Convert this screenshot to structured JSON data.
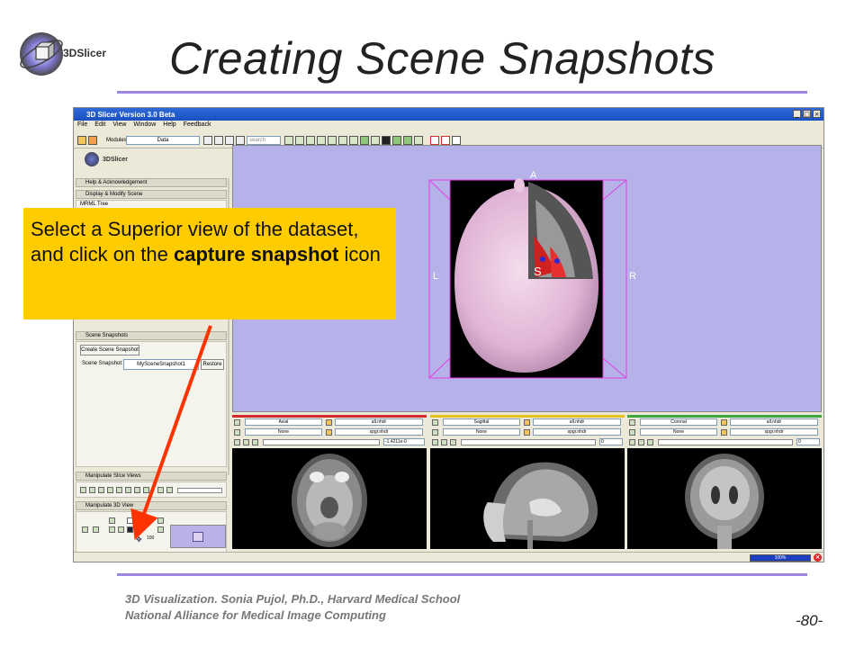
{
  "slide": {
    "title": "Creating Scene Snapshots",
    "logo_text": "3DSlicer",
    "footer_line1": "3D Visualization. Sonia Pujol, Ph.D., Harvard Medical School",
    "footer_line2": "National Alliance for Medical Image Computing",
    "page_number": "-80-"
  },
  "callout": {
    "text_part1": "Select a Superior view of the dataset, and click on the ",
    "text_bold": "capture snapshot",
    "text_part2": " icon"
  },
  "app": {
    "window_title": "3D Slicer Version 3.0 Beta",
    "window_buttons": [
      "_",
      "□",
      "×"
    ],
    "menu": [
      "File",
      "Edit",
      "View",
      "Window",
      "Help",
      "Feedback"
    ],
    "toolbar": {
      "modules_label": "Modules:",
      "module_value": "Data",
      "search_placeholder": "search modules"
    },
    "left_panel": {
      "logo_text": "3DSlicer",
      "sections": {
        "help": "Help & Acknowledgement",
        "display": "Display & Modify Scene",
        "mrml_tree": "MRML Tree",
        "scene_snapshots": "Scene Snapshots",
        "manipulate_slice": "Manipulate Slice Views",
        "manipulate_3d": "Manipulate 3D View"
      },
      "scene_snapshots": {
        "create_button": "Create Scene Snapshot",
        "snapshot_label": "Scene Snapshot:",
        "snapshot_value": "MySceneSnapshot1",
        "restore_button": "Restore"
      },
      "zoom_value": "100"
    },
    "view3d": {
      "orientation": {
        "anterior": "A",
        "left": "L",
        "right": "R",
        "superior": "S"
      }
    },
    "slice_views": [
      {
        "name": "Axial",
        "fg": "None",
        "bg": "all.nhdr",
        "label": "spgr.nhdr",
        "offset": "-1.4211e-0",
        "color": "#d42a2a"
      },
      {
        "name": "Sagittal",
        "fg": "None",
        "bg": "all.nhdr",
        "label": "spgr.nhdr",
        "offset": "0",
        "color": "#e6c21e"
      },
      {
        "name": "Coronal",
        "fg": "None",
        "bg": "all.nhdr",
        "label": "spgr.nhdr",
        "offset": "0",
        "color": "#3da63d"
      }
    ],
    "status": {
      "progress_text": "100%",
      "error_icon": "×"
    }
  },
  "colors": {
    "accent_rule": "#9b86e0",
    "callout_bg": "#ffcc00",
    "arrow": "#ff3300",
    "view3d_bg": "#b5b2ea"
  }
}
